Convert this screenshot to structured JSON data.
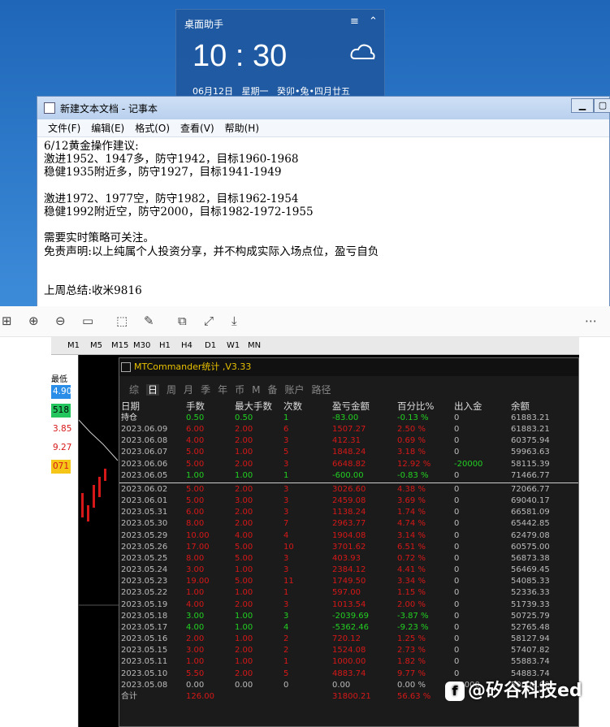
{
  "clock": {
    "title": "桌面助手",
    "time": "10 : 30",
    "date": "06月12日",
    "weekday": "星期一",
    "lunar": "癸卯•兔•四月廿五"
  },
  "notepad": {
    "title": "新建文本文档 - 记事本",
    "menu": [
      "文件(F)",
      "编辑(E)",
      "格式(O)",
      "查看(V)",
      "帮助(H)"
    ],
    "text": "6/12黄金操作建议:\n激进1952、1947多，防守1942，目标1960-1968\n稳健1935附近多，防守1927，目标1941-1949\n\n激进1972、1977空，防守1982，目标1962-1954\n稳健1992附近空，防守2000，目标1982-1972-1955\n\n需要实时策略可关注。\n免责声明:以上纯属个人投资分享，并不构成实际入场点位，盈亏自负\n\n\n上周总结:收米9816"
  },
  "toolbar": [
    "⊞",
    "⊕",
    "⊖",
    "▭",
    "⬚",
    "✎",
    "⧉",
    "⤢",
    "⤓",
    "⋯"
  ],
  "timeframes": [
    "M1",
    "M5",
    "M15",
    "M30",
    "H1",
    "H4",
    "D1",
    "W1",
    "MN"
  ],
  "leftpanel": {
    "header": "最低",
    "values": [
      {
        "v": "4.90",
        "c": "#2a8ee8",
        "fc": "#fff"
      },
      {
        "v": "518",
        "c": "#22c55e",
        "fc": "#000"
      },
      {
        "v": "3.85",
        "c": "#fff",
        "fc": "#d71818"
      },
      {
        "v": "9.27",
        "c": "#fff",
        "fc": "#d71818"
      },
      {
        "v": "071",
        "c": "#f5c518",
        "fc": "#d71818"
      }
    ]
  },
  "stat": {
    "title": "MTCommander统计 ,V3.33",
    "tabs": [
      "综",
      "日",
      "周",
      "月",
      "季",
      "年",
      "币",
      "M",
      "备",
      "账户",
      "路径"
    ],
    "headers": [
      "日期",
      "手数",
      "最大手数",
      "次数",
      "盈亏金额",
      "百分比%",
      "出入金",
      "余额"
    ],
    "rows": [
      [
        "持仓",
        "0.50",
        "0.50",
        "1",
        "-83.00",
        "-0.13 %",
        "0",
        "61883.21",
        "g"
      ],
      [
        "2023.06.09",
        "6.00",
        "2.00",
        "6",
        "1507.27",
        "2.50 %",
        "0",
        "61883.21",
        "r"
      ],
      [
        "2023.06.08",
        "4.00",
        "2.00",
        "3",
        "412.31",
        "0.69 %",
        "0",
        "60375.94",
        "r"
      ],
      [
        "2023.06.07",
        "5.00",
        "1.00",
        "5",
        "1848.24",
        "3.18 %",
        "0",
        "59963.63",
        "r"
      ],
      [
        "2023.06.06",
        "5.00",
        "2.00",
        "3",
        "6648.82",
        "12.92 %",
        "-20000",
        "58115.39",
        "r"
      ],
      [
        "2023.06.05",
        "1.00",
        "1.00",
        "1",
        "-600.00",
        "-0.83 %",
        "0",
        "71466.77",
        "g"
      ],
      [
        "2023.06.02",
        "5.00",
        "2.00",
        "3",
        "3026.60",
        "4.38 %",
        "0",
        "72066.77",
        "r"
      ],
      [
        "2023.06.01",
        "5.00",
        "3.00",
        "3",
        "2459.08",
        "3.69 %",
        "0",
        "69040.17",
        "r"
      ],
      [
        "2023.05.31",
        "6.00",
        "2.00",
        "3",
        "1138.24",
        "1.74 %",
        "0",
        "66581.09",
        "r"
      ],
      [
        "2023.05.30",
        "8.00",
        "2.00",
        "7",
        "2963.77",
        "4.74 %",
        "0",
        "65442.85",
        "r"
      ],
      [
        "2023.05.29",
        "10.00",
        "4.00",
        "4",
        "1904.08",
        "3.14 %",
        "0",
        "62479.08",
        "r"
      ],
      [
        "2023.05.26",
        "17.00",
        "5.00",
        "10",
        "3701.62",
        "6.51 %",
        "0",
        "60575.00",
        "r"
      ],
      [
        "2023.05.25",
        "8.00",
        "5.00",
        "3",
        "403.93",
        "0.72 %",
        "0",
        "56873.38",
        "r"
      ],
      [
        "2023.05.24",
        "3.00",
        "1.00",
        "3",
        "2384.12",
        "4.41 %",
        "0",
        "56469.45",
        "r"
      ],
      [
        "2023.05.23",
        "19.00",
        "5.00",
        "11",
        "1749.50",
        "3.34 %",
        "0",
        "54085.33",
        "r"
      ],
      [
        "2023.05.22",
        "1.00",
        "1.00",
        "1",
        "597.00",
        "1.15 %",
        "0",
        "52336.33",
        "r"
      ],
      [
        "2023.05.19",
        "4.00",
        "2.00",
        "3",
        "1013.54",
        "2.00 %",
        "0",
        "51739.33",
        "r"
      ],
      [
        "2023.05.18",
        "3.00",
        "1.00",
        "3",
        "-2039.69",
        "-3.87 %",
        "0",
        "50725.79",
        "g"
      ],
      [
        "2023.05.17",
        "4.00",
        "1.00",
        "4",
        "-5362.46",
        "-9.23 %",
        "0",
        "52765.48",
        "g"
      ],
      [
        "2023.05.16",
        "2.00",
        "1.00",
        "2",
        "720.12",
        "1.25 %",
        "0",
        "58127.94",
        "r"
      ],
      [
        "2023.05.15",
        "3.00",
        "2.00",
        "2",
        "1524.08",
        "2.73 %",
        "0",
        "57407.82",
        "r"
      ],
      [
        "2023.05.11",
        "1.00",
        "1.00",
        "1",
        "1000.00",
        "1.82 %",
        "0",
        "55883.74",
        "r"
      ],
      [
        "2023.05.10",
        "5.50",
        "2.00",
        "5",
        "4883.74",
        "9.77 %",
        "0",
        "54883.74",
        "r"
      ],
      [
        "2023.05.08",
        "0.00",
        "0.00",
        "0",
        "0.00",
        "0.00 %",
        "50000",
        "50000.00",
        "w"
      ],
      [
        "合计",
        "126.00",
        "",
        "",
        "31800.21",
        "56.63 %",
        "",
        "",
        "t"
      ]
    ]
  },
  "watermark": "@矽谷科技ed"
}
